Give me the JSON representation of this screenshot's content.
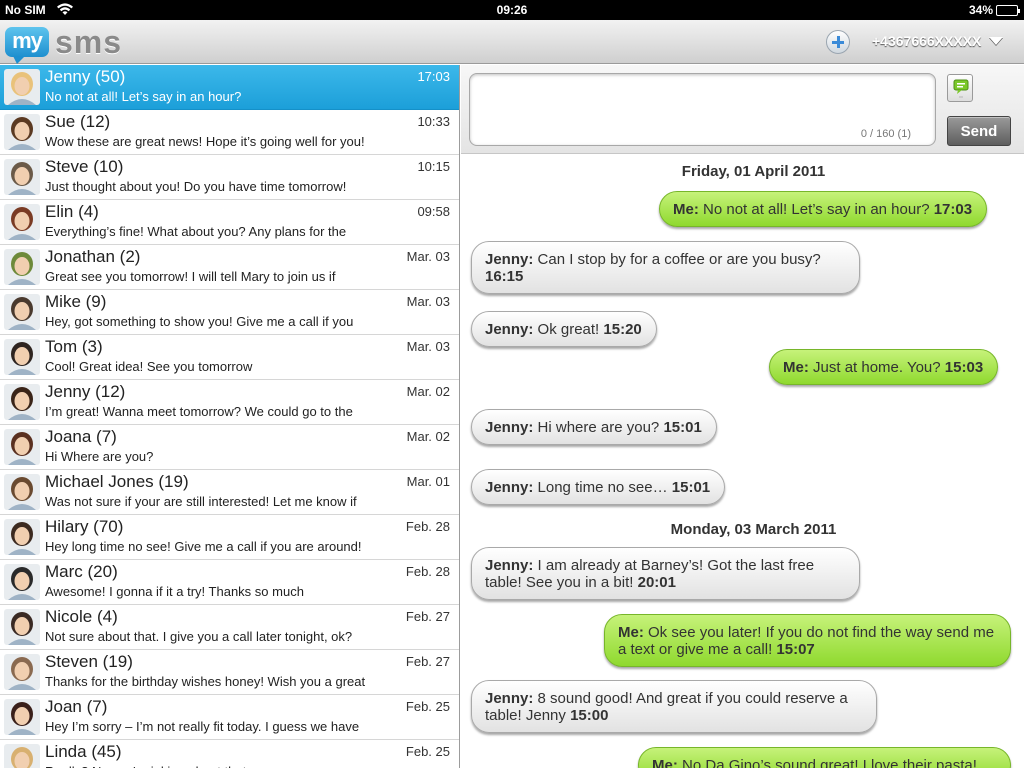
{
  "status_bar": {
    "carrier": "No SIM",
    "time": "09:26",
    "battery": "34%",
    "battery_level": 0.34
  },
  "header": {
    "logo_left": "my",
    "logo_right": "sms",
    "phone_number": "+4367666XXXXX"
  },
  "conversations": [
    {
      "name": "Jenny (50)",
      "time": "17:03",
      "preview": "No not at all! Let’s say in an hour?",
      "selected": true,
      "avatar_color": "#e9c27a"
    },
    {
      "name": "Sue (12)",
      "time": "10:33",
      "preview": "Wow these are great news! Hope it’s going well for you!",
      "avatar_color": "#5b3a22"
    },
    {
      "name": "Steve (10)",
      "time": "10:15",
      "preview": "Just thought about you! Do you have time tomorrow!",
      "avatar_color": "#6b5a48"
    },
    {
      "name": "Elin (4)",
      "time": "09:58",
      "preview": "Everything’s fine! What about you? Any plans for the",
      "avatar_color": "#7a3b24"
    },
    {
      "name": "Jonathan (2)",
      "time": "Mar. 03",
      "preview": "Great see you tomorrow! I will tell Mary to join us if",
      "avatar_color": "#6e8a3a"
    },
    {
      "name": "Mike (9)",
      "time": "Mar. 03",
      "preview": "Hey, got something to show you! Give me a call if you",
      "avatar_color": "#4a3a2e"
    },
    {
      "name": "Tom (3)",
      "time": "Mar. 03",
      "preview": "Cool! Great idea! See you tomorrow",
      "avatar_color": "#2e2420"
    },
    {
      "name": "Jenny (12)",
      "time": "Mar. 02",
      "preview": "I’m great! Wanna meet tomorrow? We could go to the",
      "avatar_color": "#3a2418"
    },
    {
      "name": "Joana (7)",
      "time": "Mar. 02",
      "preview": "Hi Where are you?",
      "avatar_color": "#5a3020"
    },
    {
      "name": "Michael Jones (19)",
      "time": "Mar. 01",
      "preview": "Was not sure if your are still interested! Let me know if",
      "avatar_color": "#6a4a30"
    },
    {
      "name": "Hilary (70)",
      "time": "Feb. 28",
      "preview": "Hey long time no see! Give me a call if you are around!",
      "avatar_color": "#3c2a20"
    },
    {
      "name": "Marc (20)",
      "time": "Feb. 28",
      "preview": "Awesome! I gonna if it a try! Thanks so much",
      "avatar_color": "#2a2a2a"
    },
    {
      "name": "Nicole (4)",
      "time": "Feb. 27",
      "preview": "Not sure about that. I give you a call later tonight, ok?",
      "avatar_color": "#3a2a24"
    },
    {
      "name": "Steven (19)",
      "time": "Feb. 27",
      "preview": "Thanks for the birthday wishes honey! Wish you a great",
      "avatar_color": "#8a6a50"
    },
    {
      "name": "Joan (7)",
      "time": "Feb. 25",
      "preview": "Hey I’m sorry – I’m not really fit today. I guess we have",
      "avatar_color": "#3a201a"
    },
    {
      "name": "Linda (45)",
      "time": "Feb. 25",
      "preview": "Really? No you're joking about that...",
      "avatar_color": "#d8b070"
    }
  ],
  "compose": {
    "placeholder": "",
    "char_count": "0 / 160 (1)",
    "send_label": "Send"
  },
  "thread": {
    "dates": [
      "Friday, 01 April 2011",
      "Monday, 03 March 2011"
    ],
    "messages": [
      {
        "sender": "Me:",
        "text": "No not at all! Let’s say in an hour?",
        "time": "17:03",
        "direction": "out"
      },
      {
        "sender": "Jenny:",
        "text": "Can I stop by for a coffee or are you busy?",
        "time": "16:15",
        "direction": "in"
      },
      {
        "sender": "Jenny:",
        "text": "Ok great!",
        "time": "15:20",
        "direction": "in"
      },
      {
        "sender": "Me:",
        "text": "Just at home. You?",
        "time": "15:03",
        "direction": "out"
      },
      {
        "sender": "Jenny:",
        "text": "Hi where are you?",
        "time": "15:01",
        "direction": "in"
      },
      {
        "sender": "Jenny:",
        "text": "Long time no see…",
        "time": "15:01",
        "direction": "in"
      },
      {
        "sender": "Jenny:",
        "text": "I am already at Barney’s! Got the last free table! See you in a bit!",
        "time": "20:01",
        "direction": "in"
      },
      {
        "sender": "Me:",
        "text": "Ok see you later! If you do not find the way send me a text or give me a call!",
        "time": "15:07",
        "direction": "out"
      },
      {
        "sender": "Jenny:",
        "text": "8 sound good! And great if you could reserve a table! Jenny",
        "time": "15:00",
        "direction": "in"
      },
      {
        "sender": "Me:",
        "text": "No Da Gino’s sound great! I love their pasta!",
        "time": "",
        "direction": "out"
      }
    ]
  },
  "icons": {
    "wifi": "wifi-icon",
    "add": "add-contact-icon",
    "dropdown": "chevron-down-icon",
    "sms": "sms-type-icon",
    "battery": "battery-icon"
  },
  "colors": {
    "accent": "#1c9fd9",
    "outgoing": "#9bdc3a",
    "incoming": "#eeeeee"
  }
}
